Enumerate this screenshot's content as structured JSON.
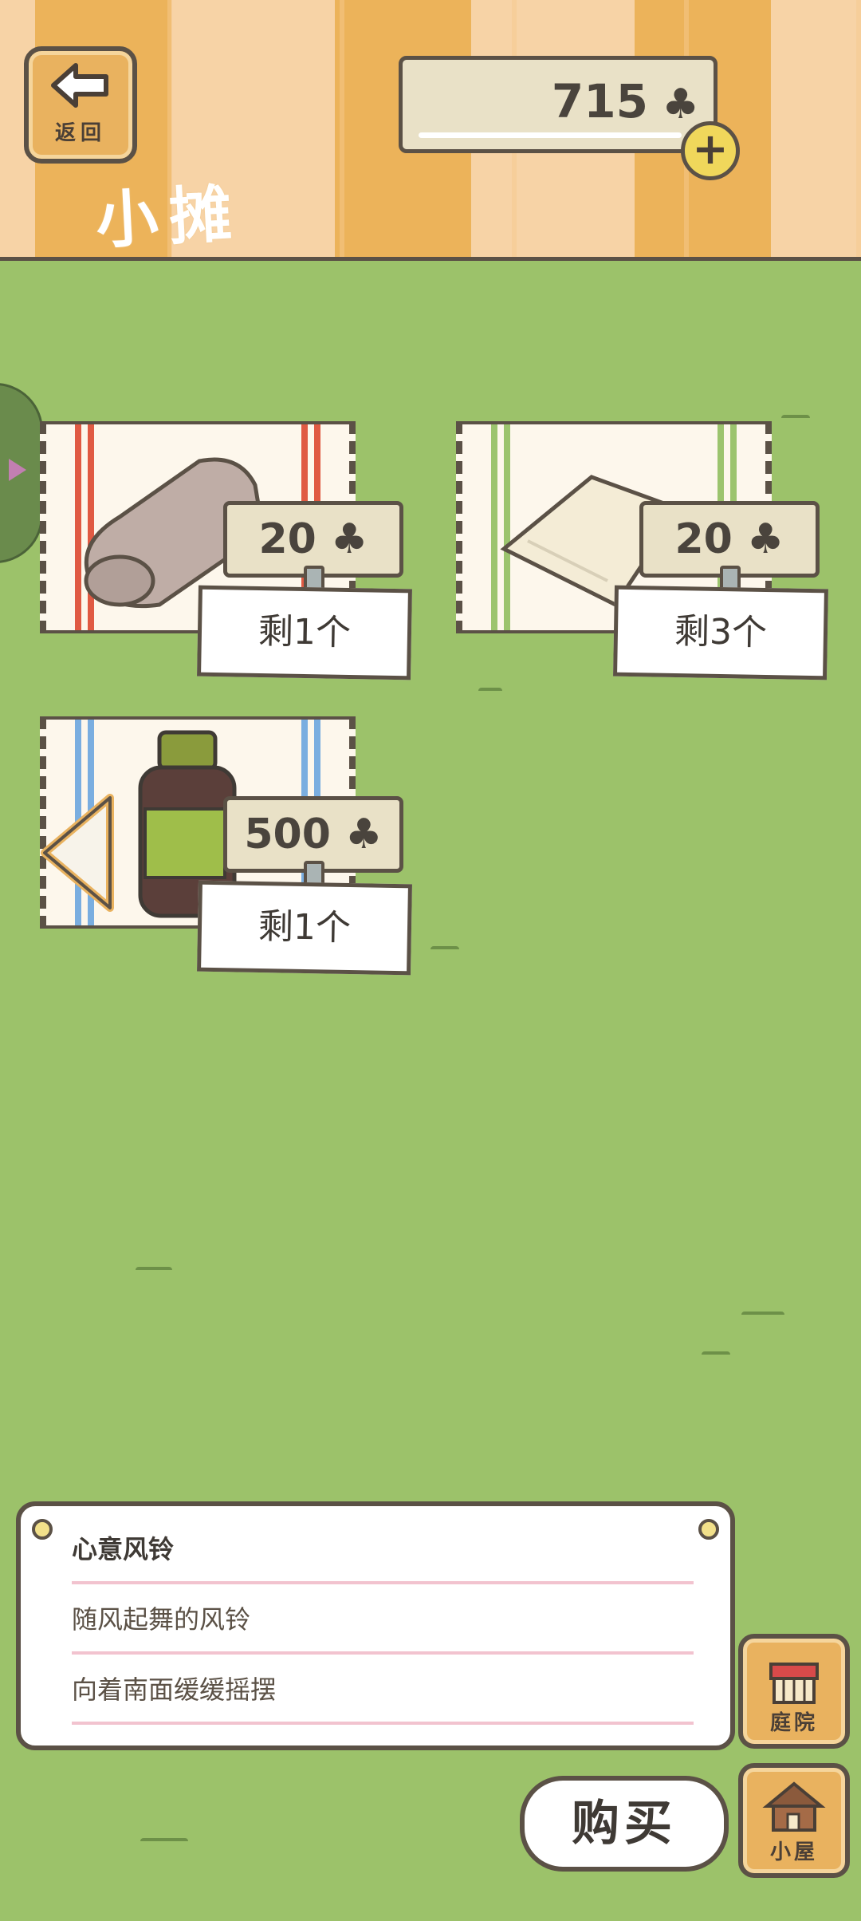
{
  "header": {
    "back_label": "返回",
    "title": "小摊",
    "coins": "715",
    "coin_symbol": "♣",
    "add_label": "+"
  },
  "items": [
    {
      "price": "20 ♣",
      "stock": "剩1个",
      "stripe_color": "#e05a43"
    },
    {
      "price": "20 ♣",
      "stock": "剩3个",
      "stripe_color": "#9cc46e"
    },
    {
      "price": "500 ♣",
      "stock": "剩1个",
      "stripe_color": "#7aaee0"
    }
  ],
  "description": {
    "name": "心意风铃",
    "line1": "随风起舞的风铃",
    "line2": "向着南面缓缓摇摆"
  },
  "buttons": {
    "buy": "购买",
    "yard": "庭院",
    "house": "小屋"
  },
  "colors": {
    "grass": "#9cc26a",
    "wood": "#e9b25f",
    "outline": "#5b5146"
  }
}
